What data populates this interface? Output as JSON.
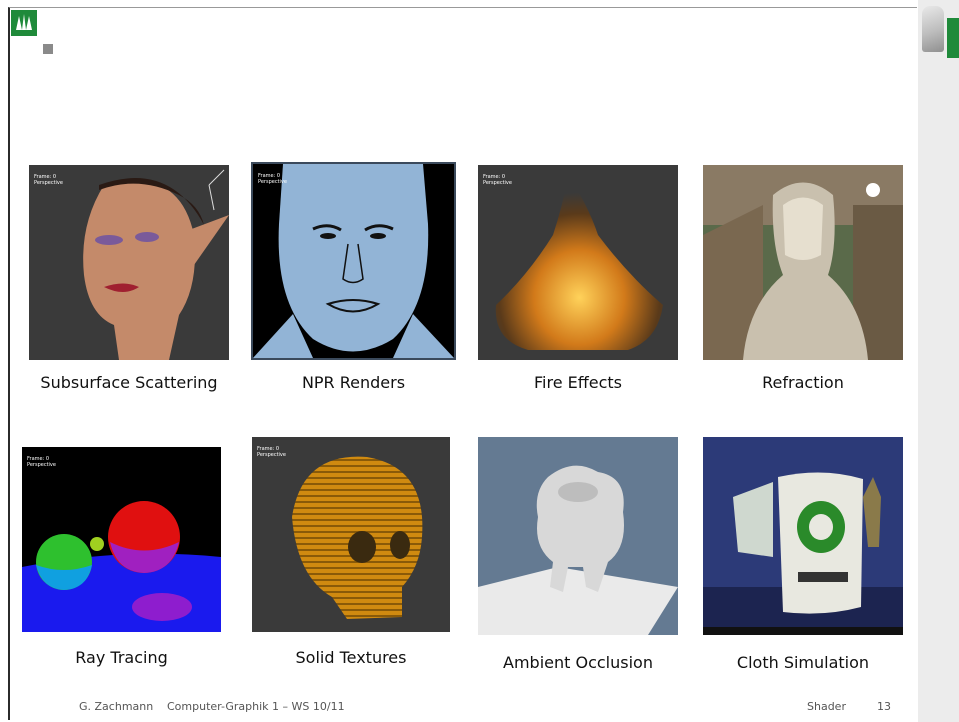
{
  "footer": {
    "author": "G. Zachmann",
    "course": "Computer-Graphik 1 – WS 10/11",
    "section": "Shader",
    "page": "13"
  },
  "thumb_overlay": {
    "frame": "Frame: 0",
    "view": "Perspective"
  },
  "colors": {
    "brand": "#1f8a3a",
    "npr_blue": "#92b4d6",
    "dark_bg": "#3a3a3a"
  },
  "grid": [
    {
      "caption": "Subsurface Scattering",
      "icon": "elf-face-render"
    },
    {
      "caption": "NPR Renders",
      "icon": "sketch-face-render"
    },
    {
      "caption": "Fire Effects",
      "icon": "fire-render"
    },
    {
      "caption": "Refraction",
      "icon": "glass-statue-render"
    },
    {
      "caption": "Ray Tracing",
      "icon": "spheres-render"
    },
    {
      "caption": "Solid Textures",
      "icon": "wood-skull-render"
    },
    {
      "caption": "Ambient Occlusion",
      "icon": "creature-render"
    },
    {
      "caption": "Cloth Simulation",
      "icon": "cloth-flag-render"
    }
  ]
}
